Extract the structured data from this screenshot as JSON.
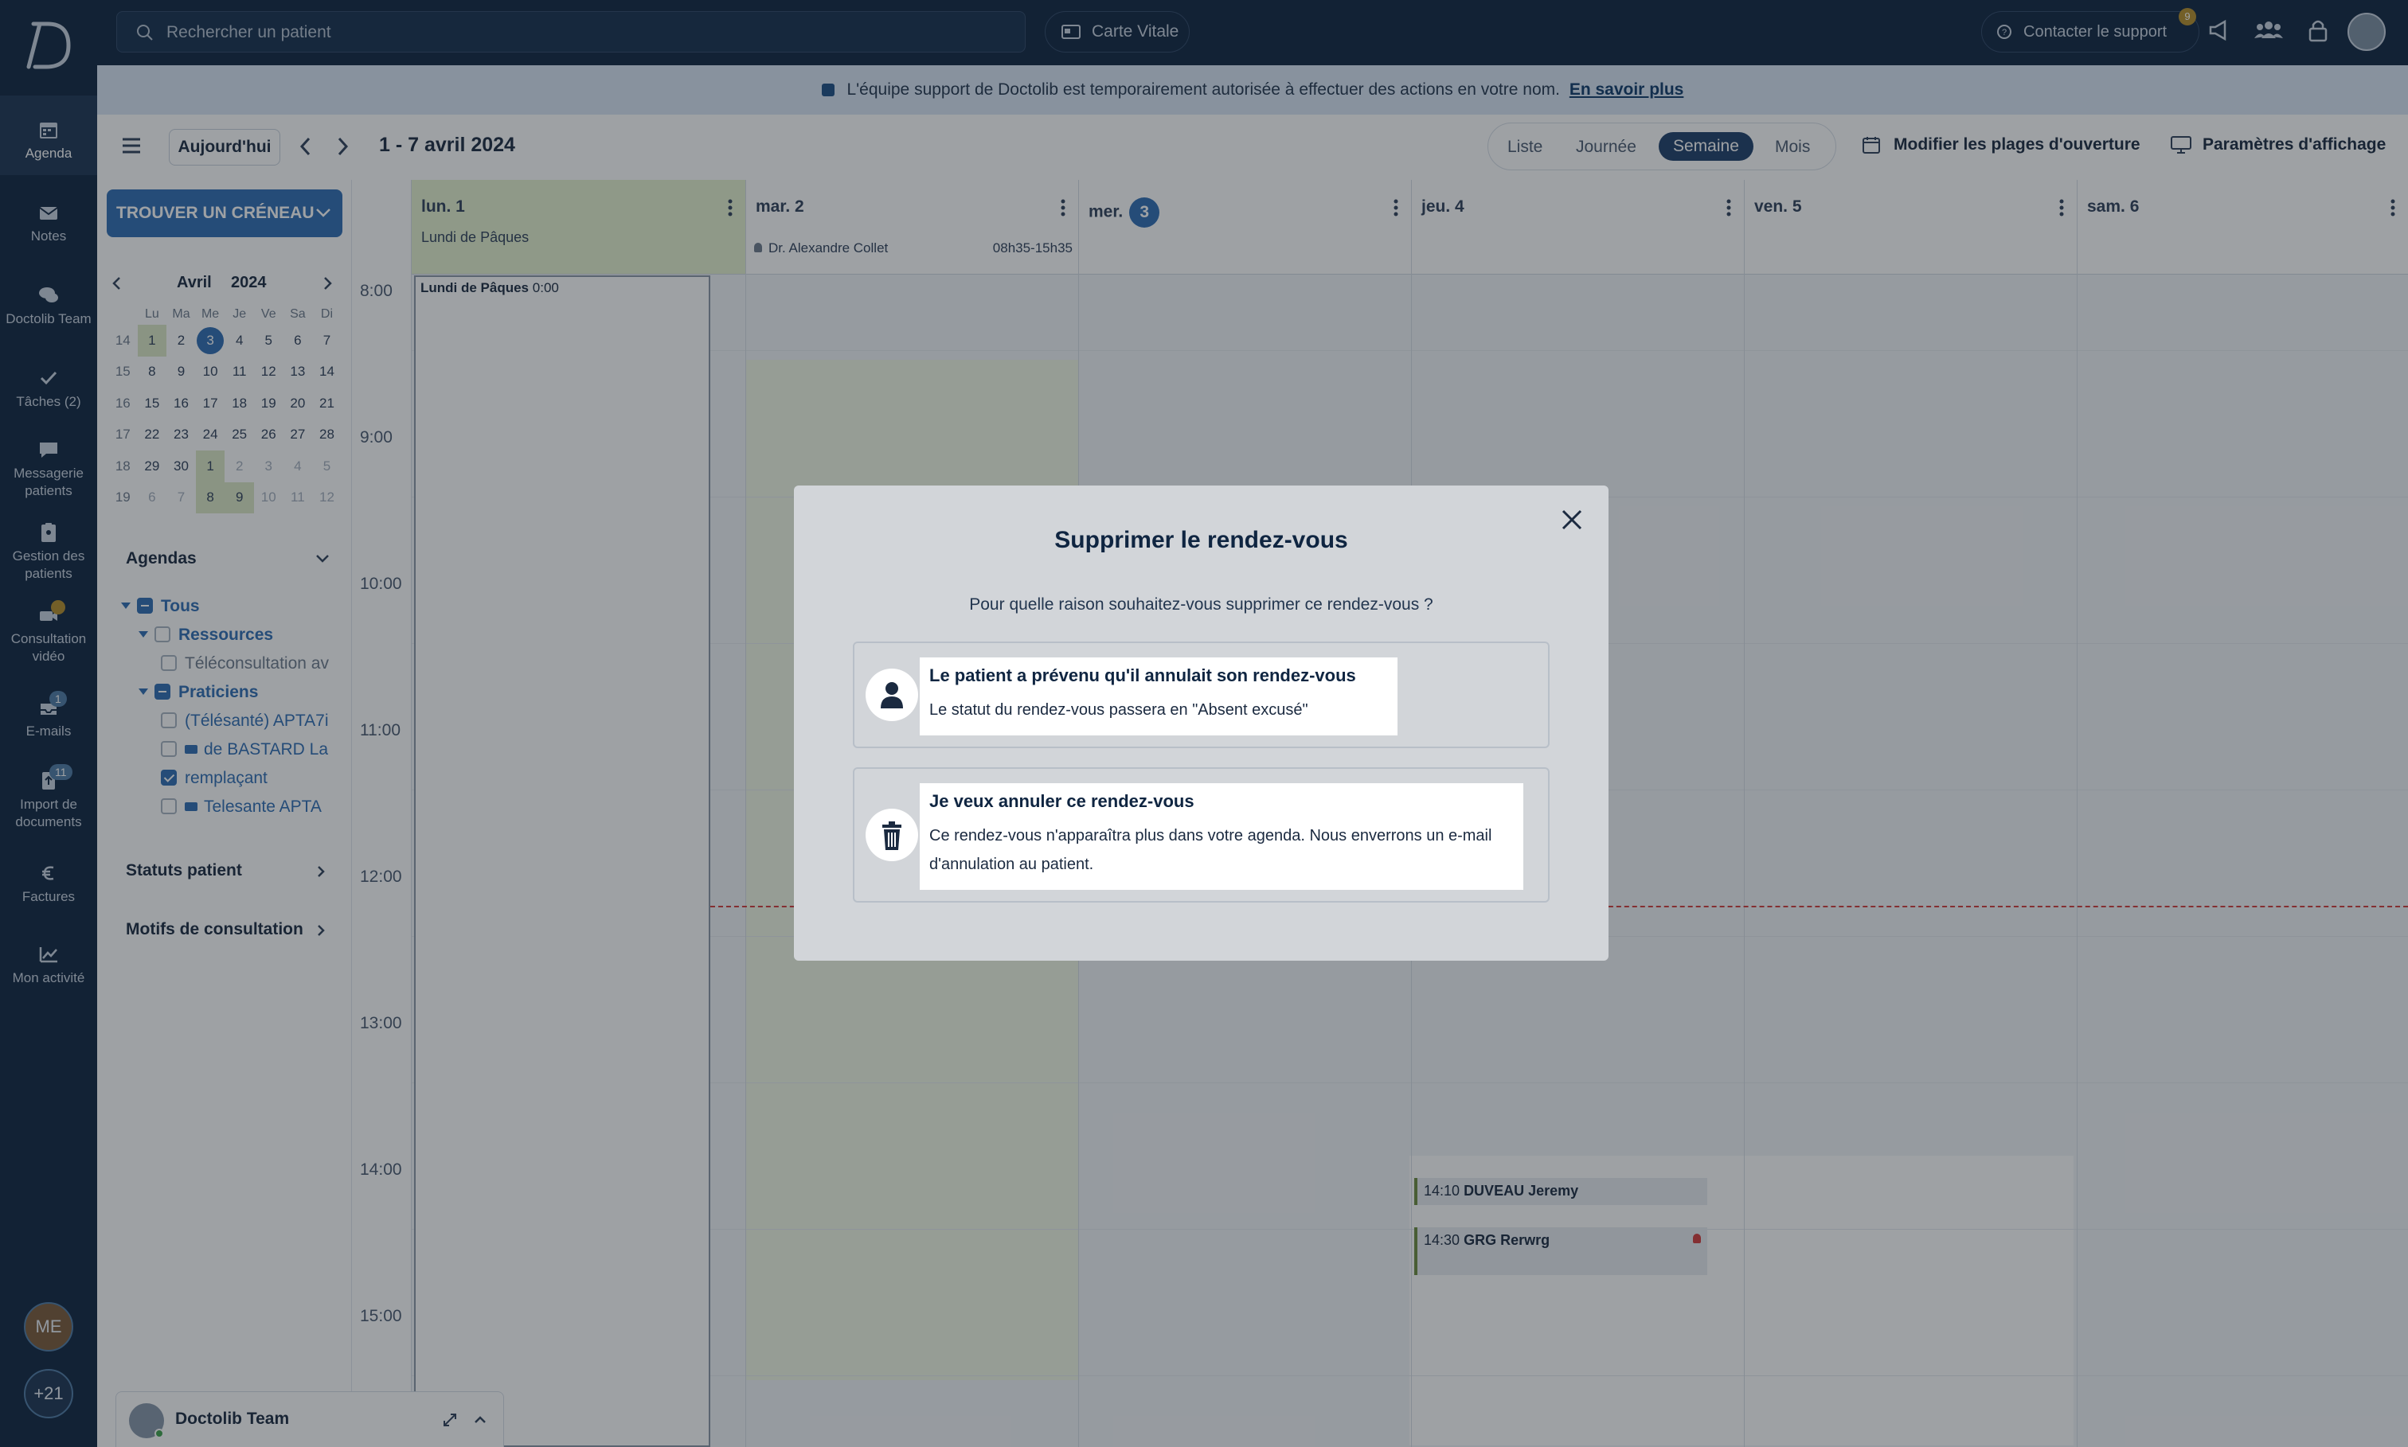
{
  "rail": {
    "items": [
      {
        "label": "Agenda"
      },
      {
        "label": "Notes"
      },
      {
        "label": "Doctolib Team"
      },
      {
        "label": "Tâches (2)"
      },
      {
        "label": "Messagerie patients"
      },
      {
        "label": "Gestion des patients"
      },
      {
        "label": "Consultation vidéo"
      },
      {
        "label": "E-mails",
        "badge": "1"
      },
      {
        "label": "Import de documents",
        "badge": "11"
      },
      {
        "label": "Factures"
      },
      {
        "label": "Mon activité"
      }
    ],
    "avatar_initials": "ME",
    "more_count": "+21"
  },
  "topbar": {
    "search_placeholder": "Rechercher un patient",
    "carte_vitale": "Carte Vitale",
    "support": "Contacter le support",
    "notif_count": "9"
  },
  "banner": {
    "text": "L'équipe support de Doctolib est temporairement autorisée à effectuer des actions en votre nom.",
    "link": "En savoir plus"
  },
  "toolbar": {
    "today": "Aujourd'hui",
    "range": "1 - 7 avril 2024",
    "views": [
      "Liste",
      "Journée",
      "Semaine",
      "Mois"
    ],
    "active_view": "Semaine",
    "opening_hours": "Modifier les plages d'ouverture",
    "display_settings": "Paramètres d'affichage"
  },
  "sidebar": {
    "find_slot": "TROUVER UN CRÉNEAU",
    "mini_cal": {
      "month": "Avril",
      "year": "2024",
      "weekdays": [
        "Lu",
        "Ma",
        "Me",
        "Je",
        "Ve",
        "Sa",
        "Di"
      ],
      "weeks": [
        {
          "wk": "14",
          "days": [
            "1",
            "2",
            "3",
            "4",
            "5",
            "6",
            "7"
          ]
        },
        {
          "wk": "15",
          "days": [
            "8",
            "9",
            "10",
            "11",
            "12",
            "13",
            "14"
          ]
        },
        {
          "wk": "16",
          "days": [
            "15",
            "16",
            "17",
            "18",
            "19",
            "20",
            "21"
          ]
        },
        {
          "wk": "17",
          "days": [
            "22",
            "23",
            "24",
            "25",
            "26",
            "27",
            "28"
          ]
        },
        {
          "wk": "18",
          "days": [
            "29",
            "30",
            "1",
            "2",
            "3",
            "4",
            "5"
          ]
        },
        {
          "wk": "19",
          "days": [
            "6",
            "7",
            "8",
            "9",
            "10",
            "11",
            "12"
          ]
        }
      ]
    },
    "agendas_title": "Agendas",
    "tree": {
      "all": "Tous",
      "resources": "Ressources",
      "teleconsult": "Téléconsultation av",
      "practitioners": "Praticiens",
      "telesante1": "(Télésanté) APTA7i",
      "bastard": "de BASTARD La",
      "remplacant": "remplaçant",
      "telesante2": "Telesante APTA"
    },
    "patient_status": "Statuts patient",
    "reasons": "Motifs de consultation"
  },
  "calendar": {
    "days": [
      {
        "label": "lun. 1",
        "note": "Lundi de Pâques"
      },
      {
        "label": "mar. 2",
        "note": ""
      },
      {
        "label": "mer.",
        "num": "3"
      },
      {
        "label": "jeu. 4"
      },
      {
        "label": "ven. 5"
      },
      {
        "label": "sam. 6"
      }
    ],
    "doctor": "Dr. Alexandre Collet",
    "doctor_hours": "08h35-15h35",
    "holiday_block": "Lundi de Pâques",
    "holiday_time": "0:00",
    "times": [
      "8:00",
      "9:00",
      "10:00",
      "11:00",
      "12:00",
      "13:00",
      "14:00",
      "15:00"
    ],
    "appointments": [
      {
        "time": "14:10",
        "name": "DUVEAU Jeremy"
      },
      {
        "time": "14:30",
        "name": "GRG Rerwrg"
      }
    ]
  },
  "team_bar": {
    "title": "Doctolib Team"
  },
  "modal": {
    "title": "Supprimer le rendez-vous",
    "question": "Pour quelle raison souhaitez-vous supprimer ce rendez-vous ?",
    "options": [
      {
        "title": "Le patient a prévenu qu'il annulait son rendez-vous",
        "desc": "Le statut du rendez-vous passera en \"Absent excusé\"",
        "icon": "person-icon"
      },
      {
        "title": "Je veux annuler ce rendez-vous",
        "desc": "Ce rendez-vous n'apparaîtra plus dans votre agenda. Nous enverrons un e-mail d'annulation au patient.",
        "icon": "trash-icon"
      }
    ]
  }
}
